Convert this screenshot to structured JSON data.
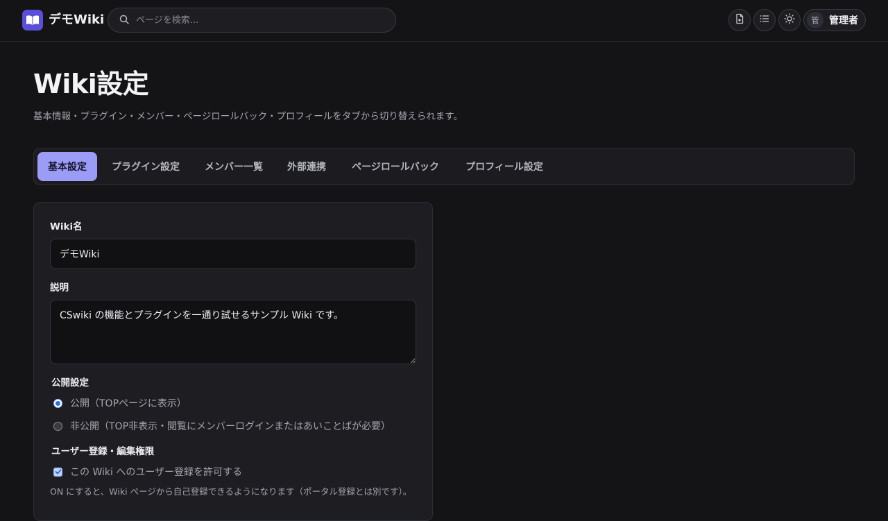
{
  "header": {
    "brand": "デモWiki",
    "search_placeholder": "ページを検索...",
    "user": {
      "avatar": "管",
      "name": "管理者"
    },
    "icons": [
      "new-page-icon",
      "list-icon",
      "sun-icon"
    ]
  },
  "page": {
    "title": "Wiki設定",
    "subtitle": "基本情報・プラグイン・メンバー・ページロールバック・プロフィールをタブから切り替えられます。"
  },
  "tabs": [
    {
      "label": "基本設定",
      "active": true
    },
    {
      "label": "プラグイン設定"
    },
    {
      "label": "メンバー一覧"
    },
    {
      "label": "外部連携"
    },
    {
      "label": "ページロールバック"
    },
    {
      "label": "プロフィール設定"
    }
  ],
  "form": {
    "name_label": "Wiki名",
    "name_value": "デモWiki",
    "desc_label": "説明",
    "desc_value": "CSwiki の機能とプラグインを一通り試せるサンプル Wiki です。",
    "visibility_label": "公開設定",
    "visibility_options": [
      {
        "label": "公開（TOPページに表示）",
        "checked": true
      },
      {
        "label": "非公開（TOP非表示・閲覧にメンバーログインまたはあいことばが必要）",
        "checked": false
      }
    ],
    "registration_label": "ユーザー登録・編集権限",
    "allow_registration_label": "この Wiki へのユーザー登録を許可する",
    "allow_registration_checked": true,
    "registration_help": "ON にすると、Wiki ページから自己登録できるようになります（ポータル登録とは別です）。"
  },
  "colors": {
    "accent": "#9a9cf6",
    "logo": "#5b4fd9",
    "background": "#141417"
  }
}
